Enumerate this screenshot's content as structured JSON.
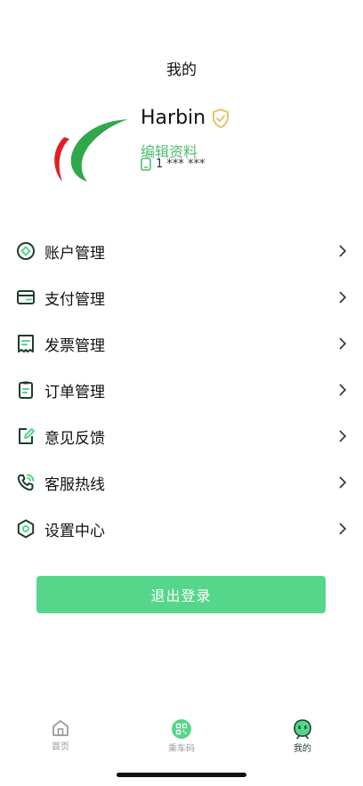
{
  "page": {
    "title": "我的"
  },
  "profile": {
    "name": "Harbin",
    "edit_label": "编辑资料",
    "phone": "1 *** ***"
  },
  "menu": {
    "items": [
      {
        "label": "账户管理",
        "icon": "account-icon"
      },
      {
        "label": "支付管理",
        "icon": "wallet-icon"
      },
      {
        "label": "发票管理",
        "icon": "invoice-icon"
      },
      {
        "label": "订单管理",
        "icon": "clipboard-icon"
      },
      {
        "label": "意见反馈",
        "icon": "feedback-edit-icon"
      },
      {
        "label": "客服热线",
        "icon": "phone-icon"
      },
      {
        "label": "设置中心",
        "icon": "settings-hexagon-icon"
      }
    ]
  },
  "logout": {
    "label": "退出登录"
  },
  "tabbar": {
    "tabs": [
      {
        "label": "首页",
        "icon": "home-icon",
        "active": false
      },
      {
        "label": "乘车码",
        "icon": "qr-code-icon",
        "active": false
      },
      {
        "label": "我的",
        "icon": "robot-face-icon",
        "active": true
      }
    ]
  },
  "colors": {
    "accent": "#55d68a",
    "accent_text": "#4fbf6e",
    "icon_dark": "#1e3d2c",
    "verified_badge": "#e8c36a"
  }
}
